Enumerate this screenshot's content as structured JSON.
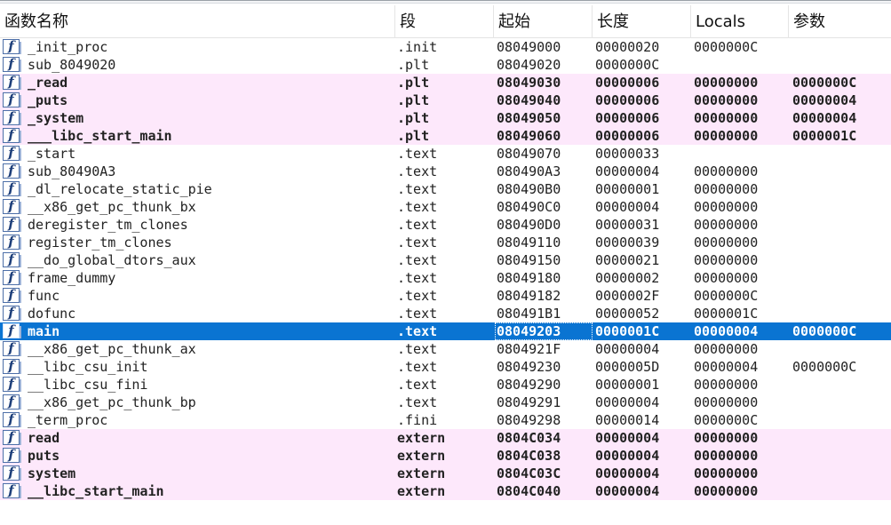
{
  "columns": {
    "name": "函数名称",
    "segment": "段",
    "start": "起始",
    "length": "长度",
    "locals": "Locals",
    "args": "参数"
  },
  "icon": {
    "glyph": "f",
    "name": "function-icon"
  },
  "colors": {
    "extern_highlight": "#fde8fb",
    "selected_row": "#0a74d2",
    "icon_border": "#4d6fa8"
  },
  "rows": [
    {
      "name": "_init_proc",
      "segment": ".init",
      "start": "08049000",
      "length": "00000020",
      "locals": "0000000C",
      "args": "",
      "style": "normal"
    },
    {
      "name": "sub_8049020",
      "segment": ".plt",
      "start": "08049020",
      "length": "0000000C",
      "locals": "",
      "args": "",
      "style": "normal"
    },
    {
      "name": "_read",
      "segment": ".plt",
      "start": "08049030",
      "length": "00000006",
      "locals": "00000000",
      "args": "0000000C",
      "style": "pink"
    },
    {
      "name": "_puts",
      "segment": ".plt",
      "start": "08049040",
      "length": "00000006",
      "locals": "00000000",
      "args": "00000004",
      "style": "pink"
    },
    {
      "name": "_system",
      "segment": ".plt",
      "start": "08049050",
      "length": "00000006",
      "locals": "00000000",
      "args": "00000004",
      "style": "pink"
    },
    {
      "name": "___libc_start_main",
      "segment": ".plt",
      "start": "08049060",
      "length": "00000006",
      "locals": "00000000",
      "args": "0000001C",
      "style": "pink"
    },
    {
      "name": "_start",
      "segment": ".text",
      "start": "08049070",
      "length": "00000033",
      "locals": "",
      "args": "",
      "style": "normal"
    },
    {
      "name": "sub_80490A3",
      "segment": ".text",
      "start": "080490A3",
      "length": "00000004",
      "locals": "00000000",
      "args": "",
      "style": "normal"
    },
    {
      "name": "_dl_relocate_static_pie",
      "segment": ".text",
      "start": "080490B0",
      "length": "00000001",
      "locals": "00000000",
      "args": "",
      "style": "normal"
    },
    {
      "name": "__x86_get_pc_thunk_bx",
      "segment": ".text",
      "start": "080490C0",
      "length": "00000004",
      "locals": "00000000",
      "args": "",
      "style": "normal"
    },
    {
      "name": "deregister_tm_clones",
      "segment": ".text",
      "start": "080490D0",
      "length": "00000031",
      "locals": "00000000",
      "args": "",
      "style": "normal"
    },
    {
      "name": "register_tm_clones",
      "segment": ".text",
      "start": "08049110",
      "length": "00000039",
      "locals": "00000000",
      "args": "",
      "style": "normal"
    },
    {
      "name": "__do_global_dtors_aux",
      "segment": ".text",
      "start": "08049150",
      "length": "00000021",
      "locals": "00000000",
      "args": "",
      "style": "normal"
    },
    {
      "name": "frame_dummy",
      "segment": ".text",
      "start": "08049180",
      "length": "00000002",
      "locals": "00000000",
      "args": "",
      "style": "normal"
    },
    {
      "name": "func",
      "segment": ".text",
      "start": "08049182",
      "length": "0000002F",
      "locals": "0000000C",
      "args": "",
      "style": "normal"
    },
    {
      "name": "dofunc",
      "segment": ".text",
      "start": "080491B1",
      "length": "00000052",
      "locals": "0000001C",
      "args": "",
      "style": "normal"
    },
    {
      "name": "main",
      "segment": ".text",
      "start": "08049203",
      "length": "0000001C",
      "locals": "00000004",
      "args": "0000000C",
      "style": "selected"
    },
    {
      "name": "__x86_get_pc_thunk_ax",
      "segment": ".text",
      "start": "0804921F",
      "length": "00000004",
      "locals": "00000000",
      "args": "",
      "style": "normal"
    },
    {
      "name": "__libc_csu_init",
      "segment": ".text",
      "start": "08049230",
      "length": "0000005D",
      "locals": "00000004",
      "args": "0000000C",
      "style": "normal"
    },
    {
      "name": "__libc_csu_fini",
      "segment": ".text",
      "start": "08049290",
      "length": "00000001",
      "locals": "00000000",
      "args": "",
      "style": "normal"
    },
    {
      "name": "__x86_get_pc_thunk_bp",
      "segment": ".text",
      "start": "08049291",
      "length": "00000004",
      "locals": "00000000",
      "args": "",
      "style": "normal"
    },
    {
      "name": "_term_proc",
      "segment": ".fini",
      "start": "08049298",
      "length": "00000014",
      "locals": "0000000C",
      "args": "",
      "style": "normal"
    },
    {
      "name": "read",
      "segment": "extern",
      "start": "0804C034",
      "length": "00000004",
      "locals": "00000000",
      "args": "",
      "style": "pink"
    },
    {
      "name": "puts",
      "segment": "extern",
      "start": "0804C038",
      "length": "00000004",
      "locals": "00000000",
      "args": "",
      "style": "pink"
    },
    {
      "name": "system",
      "segment": "extern",
      "start": "0804C03C",
      "length": "00000004",
      "locals": "00000000",
      "args": "",
      "style": "pink"
    },
    {
      "name": "__libc_start_main",
      "segment": "extern",
      "start": "0804C040",
      "length": "00000004",
      "locals": "00000000",
      "args": "",
      "style": "pink"
    }
  ]
}
